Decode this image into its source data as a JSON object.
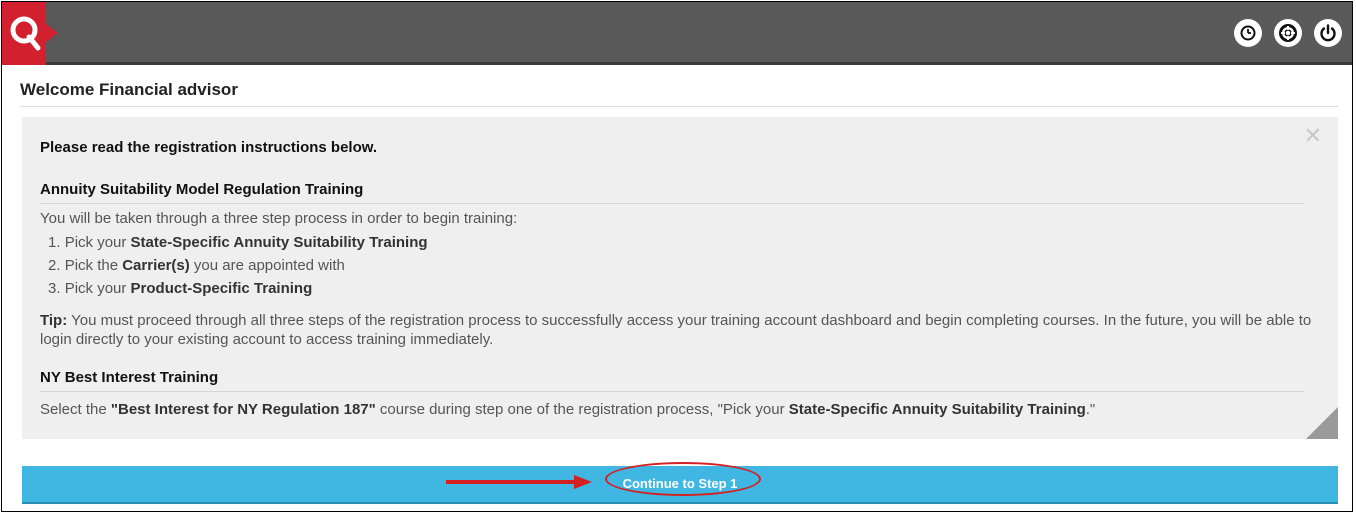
{
  "header": {
    "logo_letter": "Q",
    "icons": [
      "clock-icon",
      "lifebuoy-icon",
      "power-icon"
    ],
    "colors": {
      "bar": "#595959",
      "logo": "#d2202f"
    }
  },
  "welcome": "Welcome Financial advisor",
  "panel": {
    "title": "Please read the registration instructions below.",
    "section1": {
      "title": "Annuity Suitability Model Regulation Training",
      "intro": "You will be taken through a three step process in order to begin training:",
      "steps": [
        {
          "num": "1.",
          "pre": "Pick your ",
          "bold": "State-Specific Annuity Suitability Training",
          "post": ""
        },
        {
          "num": "2.",
          "pre": "Pick the ",
          "bold": "Carrier(s)",
          "post": " you are appointed with"
        },
        {
          "num": "3.",
          "pre": "Pick your ",
          "bold": "Product-Specific Training",
          "post": ""
        }
      ],
      "tip_label": "Tip:",
      "tip_text": " You must proceed through all three steps of the registration process to successfully access your training account dashboard and begin completing courses. In the future, you will be able to login directly to your existing account to access training immediately."
    },
    "section2": {
      "title": "NY Best Interest Training",
      "pre": "Select the ",
      "bold1": "\"Best Interest for NY Regulation 187\"",
      "mid": " course during step one of the registration process, \"Pick your ",
      "bold2": "State-Specific Annuity Suitability Training",
      "post": ".\""
    }
  },
  "continue_label": "Continue to Step 1",
  "annotation_color": "#d42020"
}
